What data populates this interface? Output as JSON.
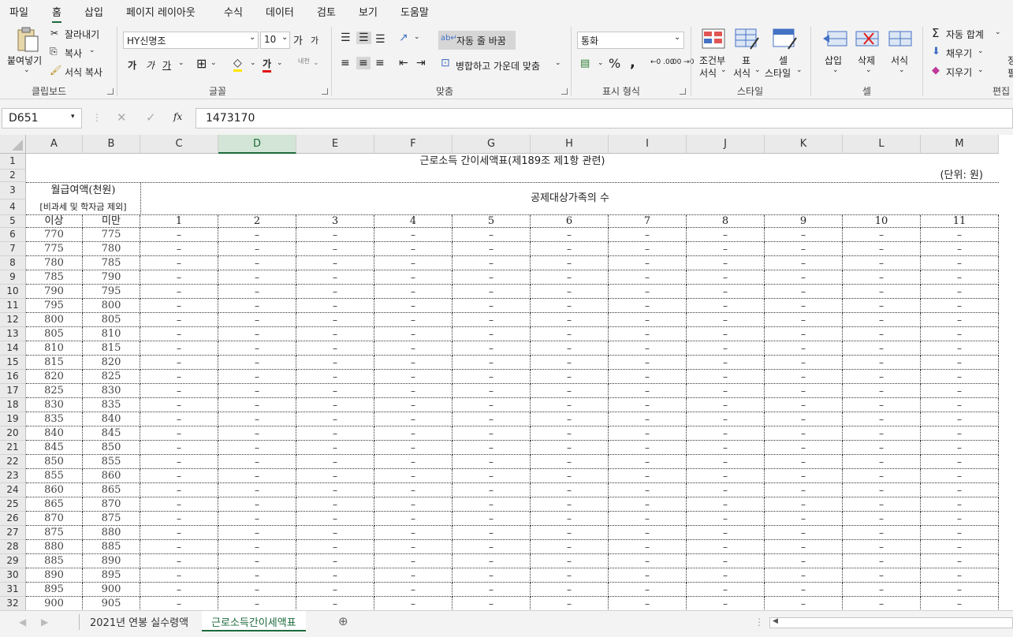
{
  "menu": [
    "파일",
    "홈",
    "삽입",
    "페이지 레이아웃",
    "수식",
    "데이터",
    "검토",
    "보기",
    "도움말"
  ],
  "ribbon": {
    "clipboard": {
      "paste": "붙여넣기",
      "cut": "잘라내기",
      "copy": "복사",
      "format_painter": "서식 복사",
      "label": "클립보드"
    },
    "font": {
      "name": "HY신명조",
      "size": "10",
      "grow": "가",
      "shrink": "가",
      "bold": "가",
      "italic": "가",
      "underline": "가",
      "color_a": "가",
      "phonetic": "내천",
      "label": "글꼴"
    },
    "align": {
      "wrap": "자동 줄 바꿈",
      "merge": "병합하고 가운데 맞춤",
      "label": "맞춤"
    },
    "number": {
      "format": "통화",
      "percent": "%",
      "comma": ",",
      "label": "표시 형식"
    },
    "styles": {
      "cond_a": "조건부",
      "cond_b": "서식",
      "table_a": "표",
      "table_b": "서식",
      "cell_a": "셀",
      "cell_b": "스타일",
      "label": "스타일"
    },
    "cells": {
      "insert": "삽입",
      "delete": "삭제",
      "format": "서식",
      "label": "셀"
    },
    "editing": {
      "autosum": "자동 합계",
      "fill": "채우기",
      "clear": "지우기",
      "label": "편집",
      "sort_a": "정",
      "sort_b": "필"
    }
  },
  "formula_bar": {
    "name_box": "D651",
    "formula": "1473170",
    "fx": "fx"
  },
  "columns": [
    "A",
    "B",
    "C",
    "D",
    "E",
    "F",
    "G",
    "H",
    "I",
    "J",
    "K",
    "L",
    "M"
  ],
  "rows": [
    "1",
    "2",
    "3",
    "4",
    "5",
    "6",
    "7",
    "8",
    "9",
    "10",
    "11",
    "12",
    "13",
    "14",
    "15",
    "16",
    "17",
    "18",
    "19",
    "20",
    "21",
    "22",
    "23",
    "24",
    "25",
    "26",
    "27",
    "28",
    "29",
    "30",
    "31",
    "32"
  ],
  "sheet": {
    "title": "근로소득 간이세액표(제189조 제1항 관련)",
    "unit": "(단위: 원)",
    "hdr_monthly": "월급여액(천원)",
    "hdr_monthly_sub": "[비과세 및 학자금 제외]",
    "hdr_family": "공제대상가족의 수",
    "hdr_min": "이상",
    "hdr_max": "미만",
    "family_counts": [
      "1",
      "2",
      "3",
      "4",
      "5",
      "6",
      "7",
      "8",
      "9",
      "10",
      "11"
    ],
    "ranges": [
      [
        "770",
        "775"
      ],
      [
        "775",
        "780"
      ],
      [
        "780",
        "785"
      ],
      [
        "785",
        "790"
      ],
      [
        "790",
        "795"
      ],
      [
        "795",
        "800"
      ],
      [
        "800",
        "805"
      ],
      [
        "805",
        "810"
      ],
      [
        "810",
        "815"
      ],
      [
        "815",
        "820"
      ],
      [
        "820",
        "825"
      ],
      [
        "825",
        "830"
      ],
      [
        "830",
        "835"
      ],
      [
        "835",
        "840"
      ],
      [
        "840",
        "845"
      ],
      [
        "845",
        "850"
      ],
      [
        "850",
        "855"
      ],
      [
        "855",
        "860"
      ],
      [
        "860",
        "865"
      ],
      [
        "865",
        "870"
      ],
      [
        "870",
        "875"
      ],
      [
        "875",
        "880"
      ],
      [
        "880",
        "885"
      ],
      [
        "885",
        "890"
      ],
      [
        "890",
        "895"
      ],
      [
        "895",
        "900"
      ],
      [
        "900",
        "905"
      ]
    ],
    "dash": "–"
  },
  "tabs": [
    "2021년 연봉 실수령액",
    "근로소득간이세액표"
  ],
  "active_tab": 1
}
